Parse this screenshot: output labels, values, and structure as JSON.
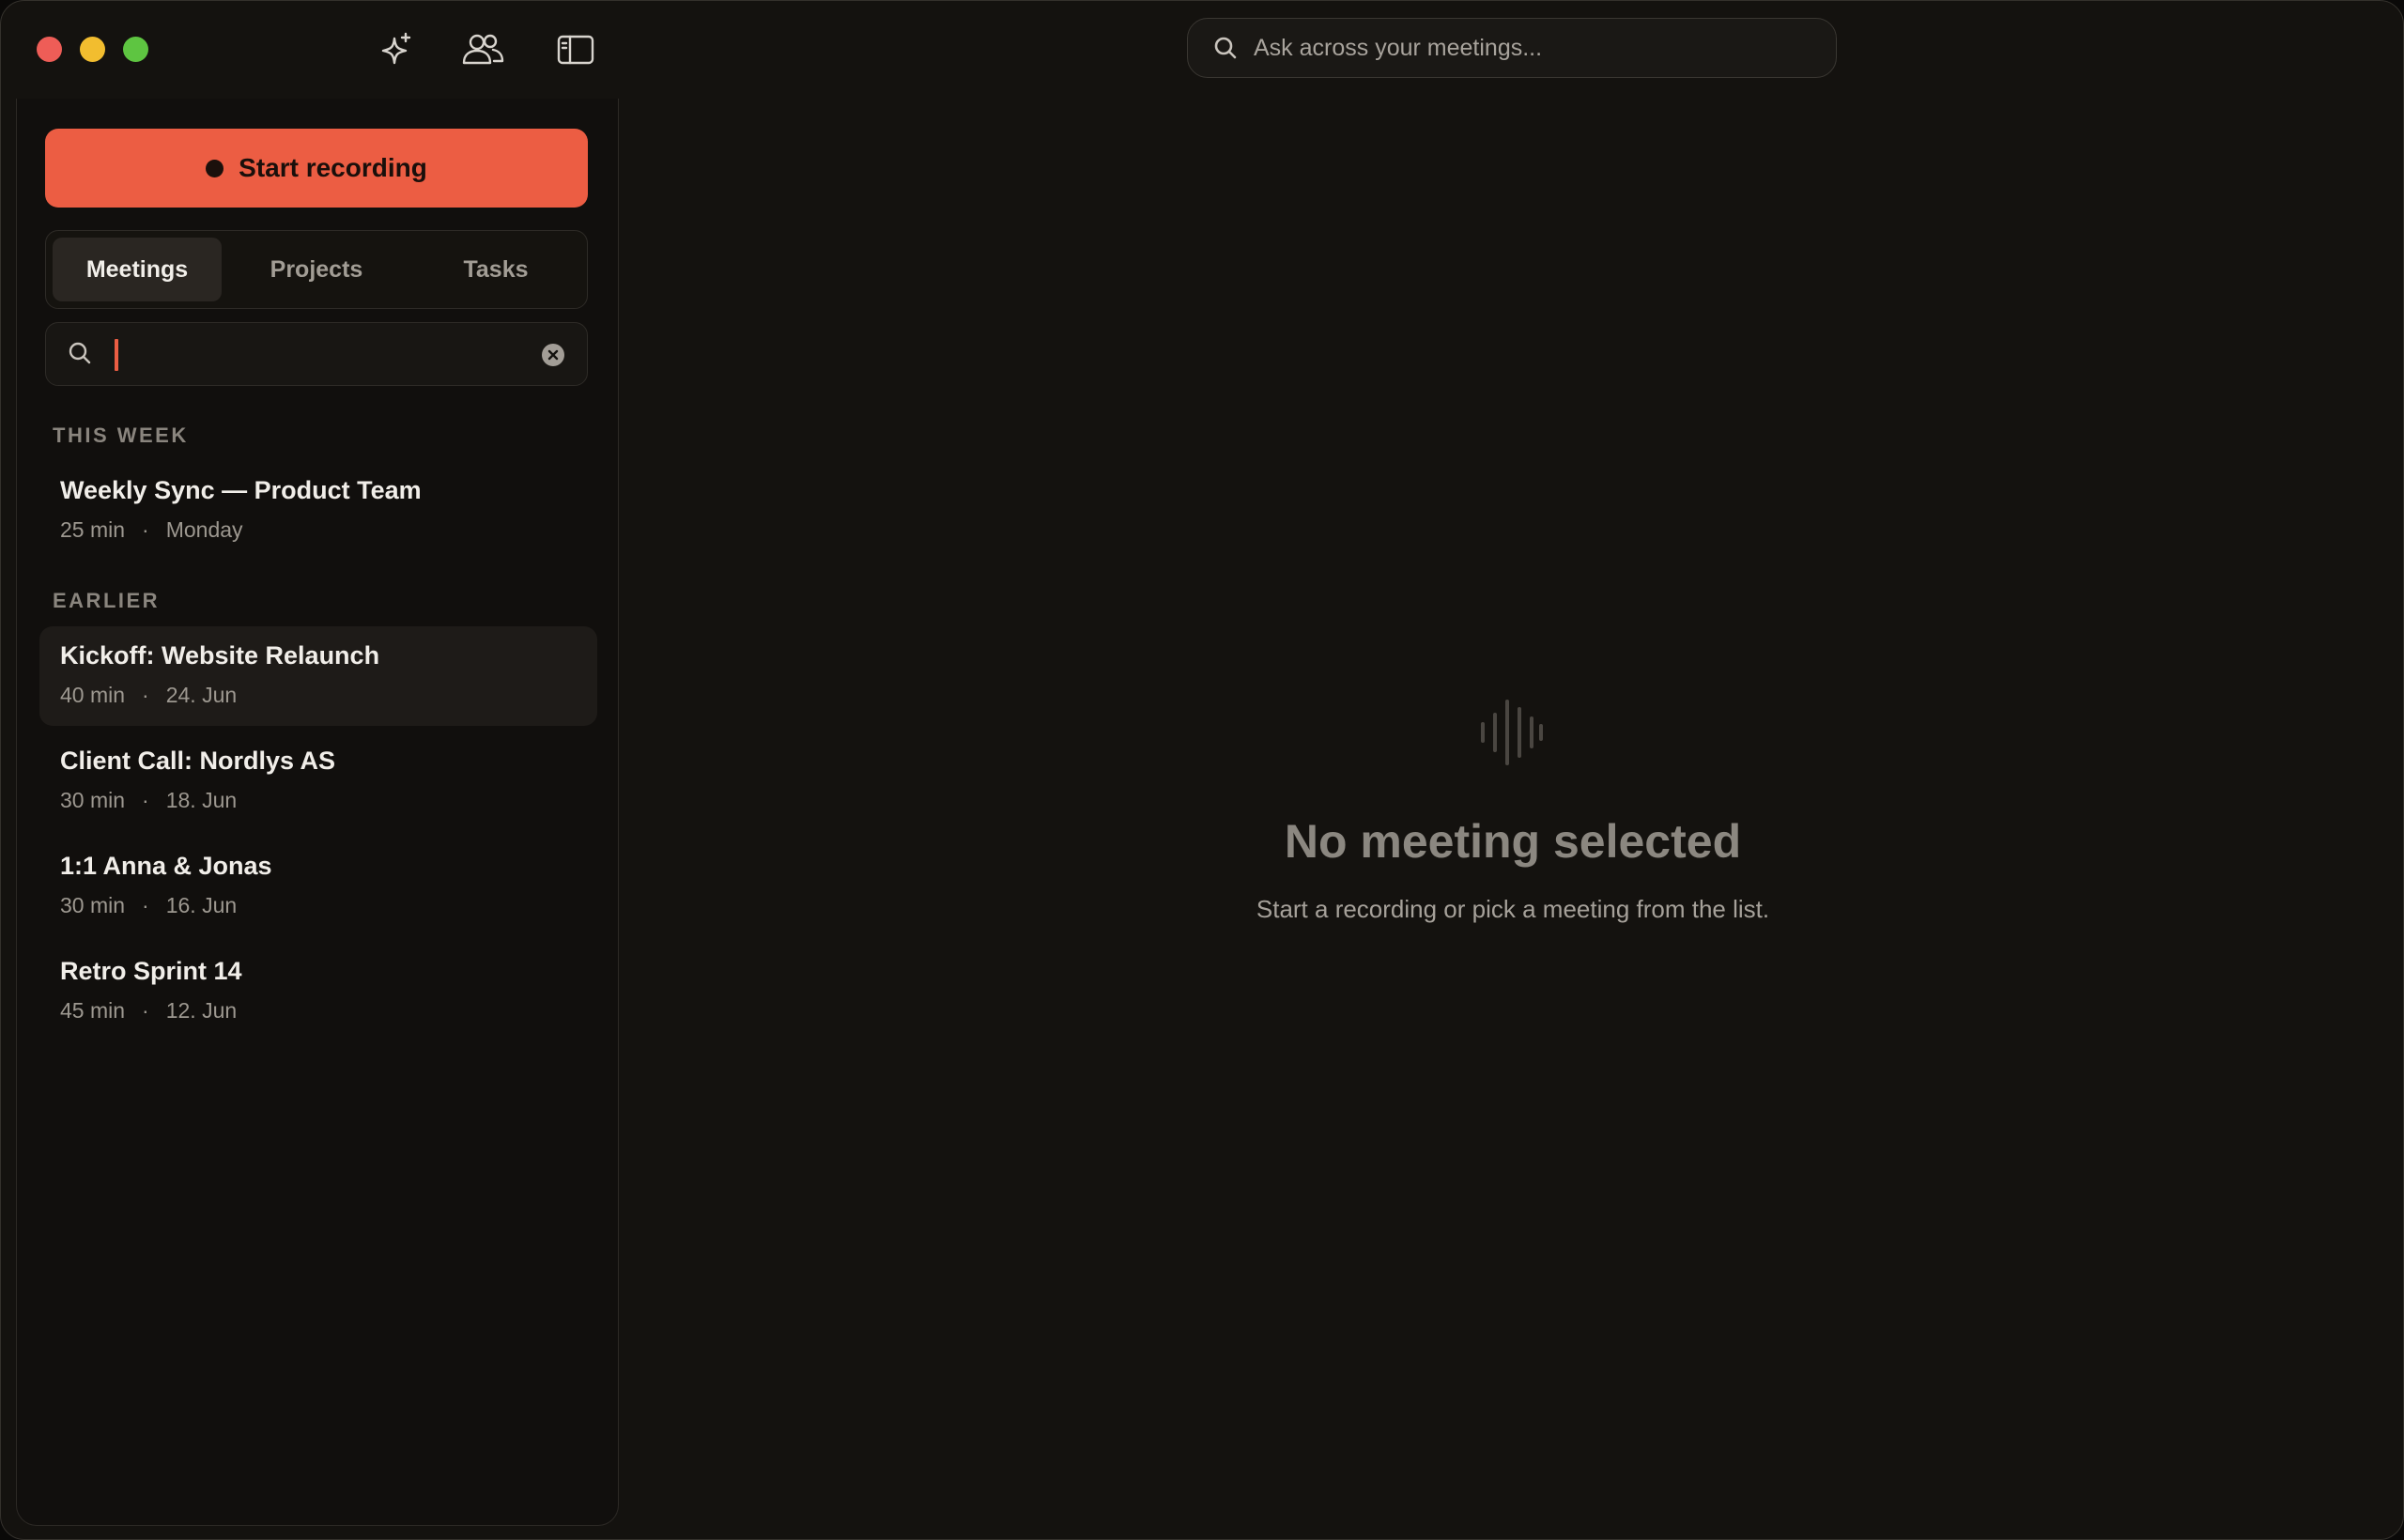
{
  "titlebar": {
    "icons": [
      "sparkle-icon",
      "people-icon",
      "sidebar-toggle-icon"
    ]
  },
  "top_search": {
    "placeholder": "Ask across your meetings..."
  },
  "sidebar": {
    "record_button": "Start recording",
    "tabs": [
      {
        "label": "Meetings",
        "active": true
      },
      {
        "label": "Projects",
        "active": false
      },
      {
        "label": "Tasks",
        "active": false
      }
    ],
    "search": {
      "value": ""
    },
    "sections": [
      {
        "heading": "THIS WEEK",
        "items": [
          {
            "title": "Weekly Sync — Product Team",
            "duration": "25 min",
            "date": "Monday"
          }
        ]
      },
      {
        "heading": "EARLIER",
        "items": [
          {
            "title": "Kickoff: Website Relaunch",
            "duration": "40 min",
            "date": "24. Jun",
            "selected": true
          },
          {
            "title": "Client Call: Nordlys AS",
            "duration": "30 min",
            "date": "18. Jun"
          },
          {
            "title": "1:1 Anna & Jonas",
            "duration": "30 min",
            "date": "16. Jun"
          },
          {
            "title": "Retro Sprint 14",
            "duration": "45 min",
            "date": "12. Jun"
          }
        ]
      }
    ],
    "separator": "·"
  },
  "empty_state": {
    "icon": "waveform-icon",
    "title": "No meeting selected",
    "subtitle": "Start a recording or pick a meeting from the list."
  },
  "colors": {
    "accent": "#ec5d43",
    "background": "#14120f"
  }
}
